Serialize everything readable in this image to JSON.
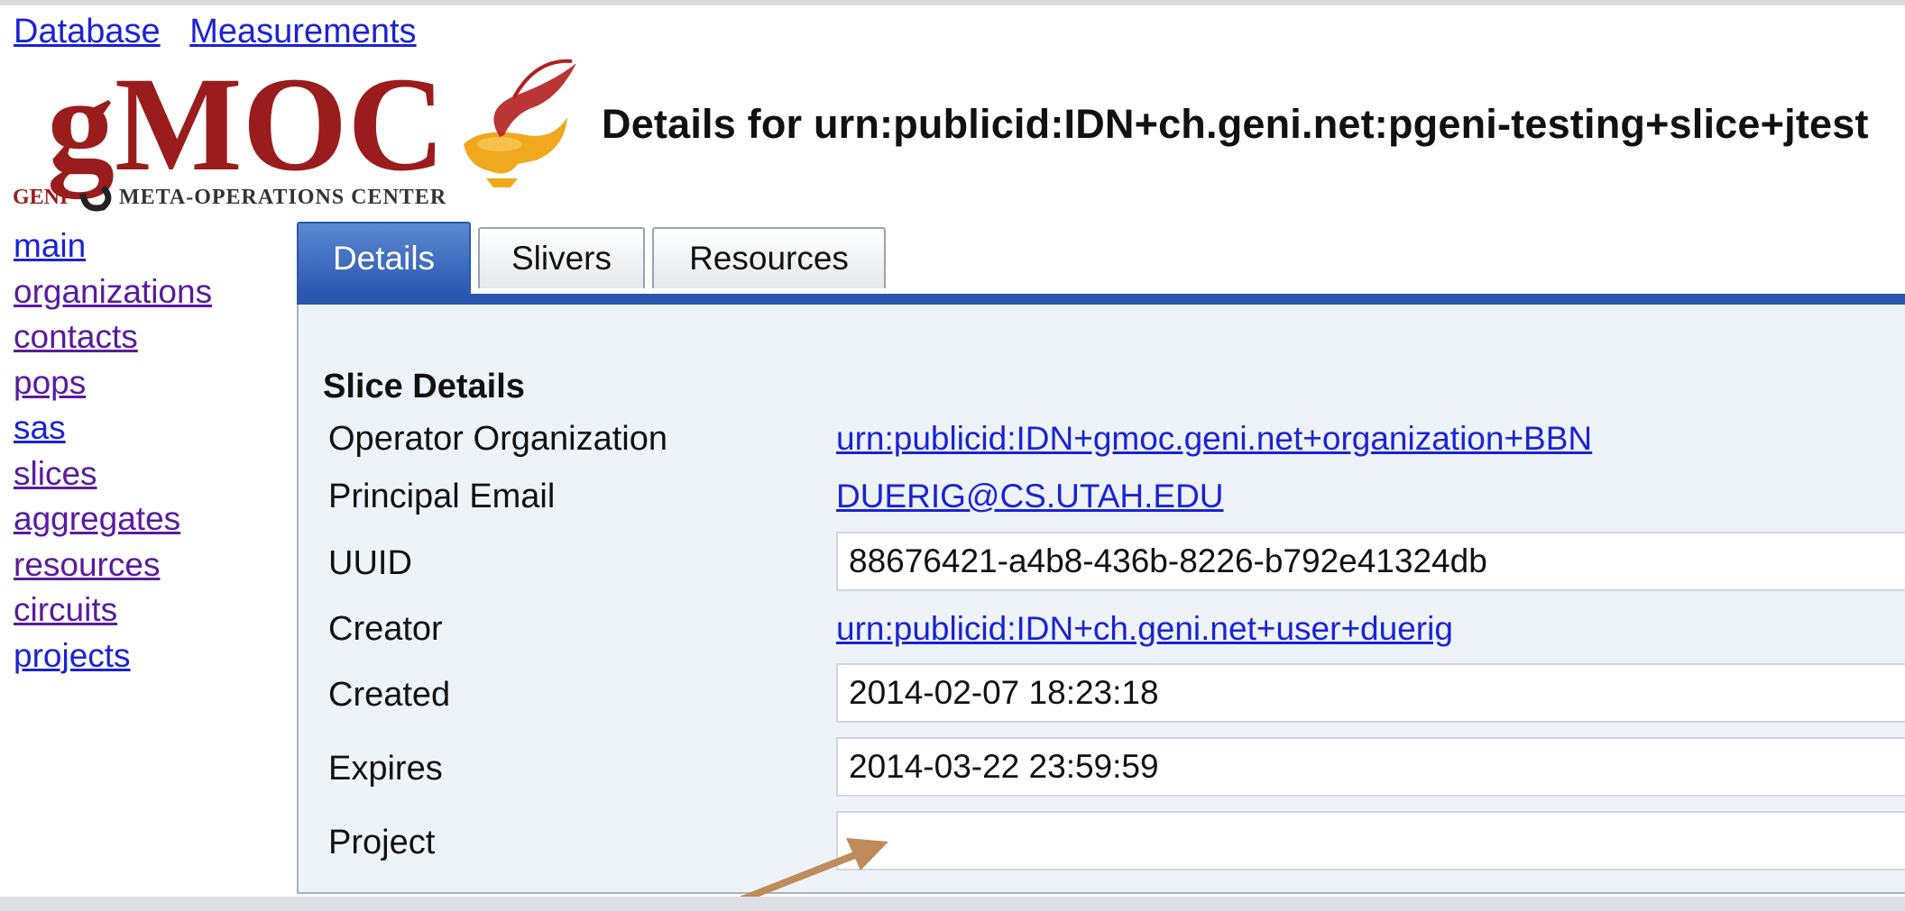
{
  "topnav": {
    "database": "Database",
    "measurements": "Measurements"
  },
  "logo": {
    "brand": "gMOC",
    "geni": "GENI",
    "tagline": "META-OPERATIONS CENTER"
  },
  "page_title": "Details for urn:publicid:IDN+ch.geni.net:pgeni-testing+slice+jtest",
  "sidebar": {
    "items": [
      {
        "label": "main"
      },
      {
        "label": "organizations"
      },
      {
        "label": "contacts"
      },
      {
        "label": "pops"
      },
      {
        "label": "sas"
      },
      {
        "label": "slices"
      },
      {
        "label": "aggregates"
      },
      {
        "label": "resources"
      },
      {
        "label": "circuits"
      },
      {
        "label": "projects"
      }
    ]
  },
  "tabs": [
    {
      "label": "Details",
      "active": true
    },
    {
      "label": "Slivers",
      "active": false
    },
    {
      "label": "Resources",
      "active": false
    }
  ],
  "slice_details": {
    "title": "Slice Details",
    "operator_org": {
      "label": "Operator Organization",
      "value": "urn:publicid:IDN+gmoc.geni.net+organization+BBN"
    },
    "principal_email": {
      "label": "Principal Email",
      "value": "DUERIG@CS.UTAH.EDU"
    },
    "uuid": {
      "label": "UUID",
      "value": "88676421-a4b8-436b-8226-b792e41324db"
    },
    "creator": {
      "label": "Creator",
      "value": "urn:publicid:IDN+ch.geni.net+user+duerig"
    },
    "created": {
      "label": "Created",
      "value": "2014-02-07 18:23:18"
    },
    "expires": {
      "label": "Expires",
      "value": "2014-03-22 23:59:59"
    },
    "project": {
      "label": "Project",
      "value": ""
    }
  },
  "colors": {
    "link": "#1a23d6",
    "visited": "#5a1aa0",
    "tab_active": "#2a57b0",
    "panel_bg": "#eef3fa",
    "arrow": "#c08a5a",
    "logo_red": "#9b1c1c",
    "logo_gold": "#f0a81e"
  }
}
